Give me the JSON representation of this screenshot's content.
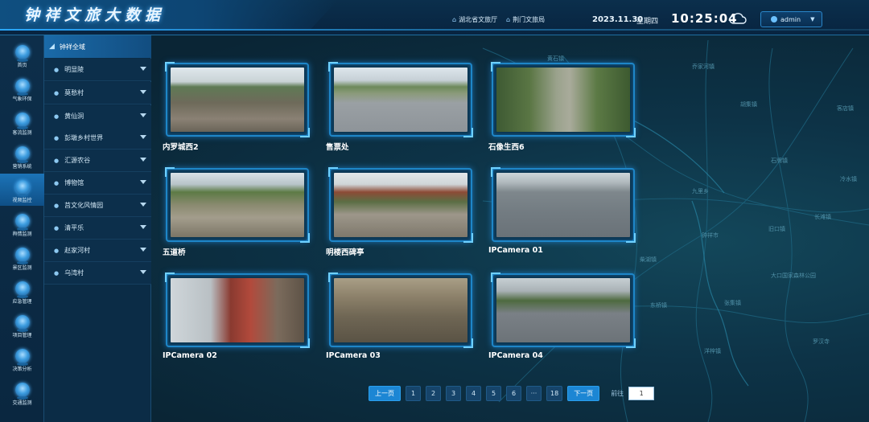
{
  "header": {
    "title": "钟祥文旅大数据",
    "links": [
      "湖北省文旅厅",
      "荆门文旅局"
    ],
    "date": "2023.11.30",
    "weekday": "星期四",
    "time": "10:25:04",
    "user": "admin"
  },
  "icon_nav": [
    {
      "label": "首页",
      "icon": "home-icon"
    },
    {
      "label": "气象环保",
      "icon": "weather-icon"
    },
    {
      "label": "客流监测",
      "icon": "people-icon"
    },
    {
      "label": "营销系统",
      "icon": "marketing-icon"
    },
    {
      "label": "视频监控",
      "icon": "camera-icon",
      "active": true
    },
    {
      "label": "舆情监测",
      "icon": "opinion-icon"
    },
    {
      "label": "景区监测",
      "icon": "scenic-icon"
    },
    {
      "label": "应急管理",
      "icon": "emergency-icon"
    },
    {
      "label": "项目管理",
      "icon": "project-icon"
    },
    {
      "label": "决策分析",
      "icon": "analysis-icon"
    },
    {
      "label": "交通监测",
      "icon": "traffic-icon"
    }
  ],
  "regions": {
    "header": "钟祥全域",
    "items": [
      "明显陵",
      "莫愁村",
      "黄仙洞",
      "彭墩乡村世界",
      "汇源农谷",
      "博物馆",
      "莒文化风情园",
      "清平乐",
      "赵家河村",
      "乌湾村"
    ]
  },
  "cameras": [
    {
      "name": "内罗城西2"
    },
    {
      "name": "售票处"
    },
    {
      "name": "石像生西6"
    },
    {
      "name": "五道桥"
    },
    {
      "name": "明楼西碑亭"
    },
    {
      "name": "IPCamera 01"
    },
    {
      "name": "IPCamera 02"
    },
    {
      "name": "IPCamera 03"
    },
    {
      "name": "IPCamera 04"
    }
  ],
  "pagination": {
    "prev": "上一页",
    "pages": [
      "1",
      "2",
      "3",
      "4",
      "5",
      "6",
      "···",
      "18"
    ],
    "next": "下一页",
    "goto_label": "前往",
    "goto_value": "1"
  },
  "map_labels": [
    "黄石镇",
    "乔家河镇",
    "客店镇",
    "胡集镇",
    "石牌镇",
    "冷水镇",
    "九里乡",
    "长滩镇",
    "旧口镇",
    "钟祥市",
    "柴湖镇",
    "东桥镇",
    "张集镇",
    "大口国家森林公园",
    "洋梓镇",
    "罗汉寺"
  ],
  "colors": {
    "accent": "#1c86d4",
    "frame": "#1e86c8",
    "header_bg": "#0b2f4c",
    "sidebar_active": "#1c74b8"
  }
}
